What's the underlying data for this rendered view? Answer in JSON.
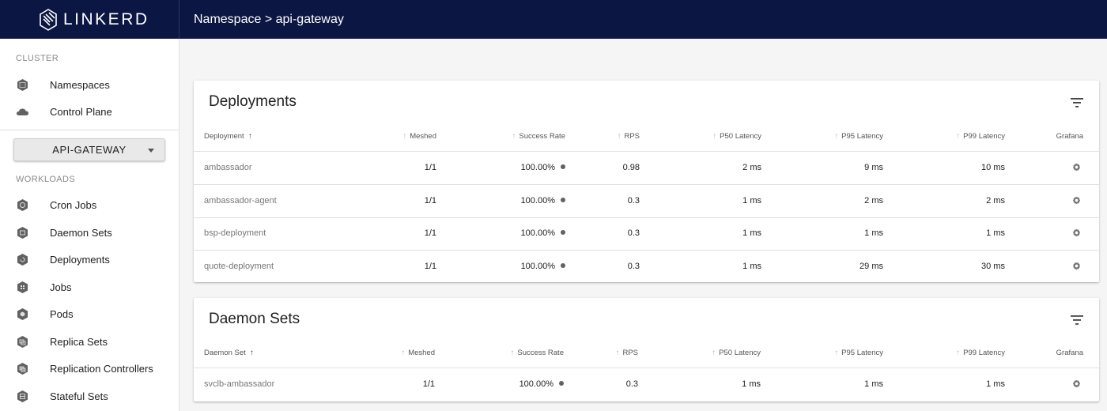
{
  "header": {
    "logo_text": "LINKERD",
    "breadcrumb": "Namespace > api-gateway"
  },
  "sidebar": {
    "cluster_label": "CLUSTER",
    "cluster_items": [
      {
        "label": "Namespaces",
        "icon": "namespaces-icon"
      },
      {
        "label": "Control Plane",
        "icon": "cloud-icon"
      }
    ],
    "namespace_select": "API-GATEWAY",
    "workloads_label": "WORKLOADS",
    "workload_items": [
      {
        "label": "Cron Jobs",
        "icon": "cronjob-icon"
      },
      {
        "label": "Daemon Sets",
        "icon": "daemonset-icon"
      },
      {
        "label": "Deployments",
        "icon": "deployment-icon"
      },
      {
        "label": "Jobs",
        "icon": "job-icon"
      },
      {
        "label": "Pods",
        "icon": "pod-icon"
      },
      {
        "label": "Replica Sets",
        "icon": "replicaset-icon"
      },
      {
        "label": "Replication Controllers",
        "icon": "replicationcontroller-icon"
      },
      {
        "label": "Stateful Sets",
        "icon": "statefulset-icon"
      }
    ]
  },
  "deployments": {
    "title": "Deployments",
    "columns": [
      "Deployment",
      "Meshed",
      "Success Rate",
      "RPS",
      "P50 Latency",
      "P95 Latency",
      "P99 Latency",
      "Grafana"
    ],
    "rows": [
      {
        "name": "ambassador",
        "meshed": "1/1",
        "success_rate": "100.00%",
        "rps": "0.98",
        "p50": "2 ms",
        "p95": "9 ms",
        "p99": "10 ms"
      },
      {
        "name": "ambassador-agent",
        "meshed": "1/1",
        "success_rate": "100.00%",
        "rps": "0.3",
        "p50": "1 ms",
        "p95": "2 ms",
        "p99": "2 ms"
      },
      {
        "name": "bsp-deployment",
        "meshed": "1/1",
        "success_rate": "100.00%",
        "rps": "0.3",
        "p50": "1 ms",
        "p95": "1 ms",
        "p99": "1 ms"
      },
      {
        "name": "quote-deployment",
        "meshed": "1/1",
        "success_rate": "100.00%",
        "rps": "0.3",
        "p50": "1 ms",
        "p95": "29 ms",
        "p99": "30 ms"
      }
    ]
  },
  "daemonsets": {
    "title": "Daemon Sets",
    "columns": [
      "Daemon Set",
      "Meshed",
      "Success Rate",
      "RPS",
      "P50 Latency",
      "P95 Latency",
      "P99 Latency",
      "Grafana"
    ],
    "rows": [
      {
        "name": "svclb-ambassador",
        "meshed": "1/1",
        "success_rate": "100.00%",
        "rps": "0.3",
        "p50": "1 ms",
        "p95": "1 ms",
        "p99": "1 ms"
      }
    ]
  },
  "colors": {
    "topbar": "#0b1642",
    "status_dot": "#616161"
  }
}
